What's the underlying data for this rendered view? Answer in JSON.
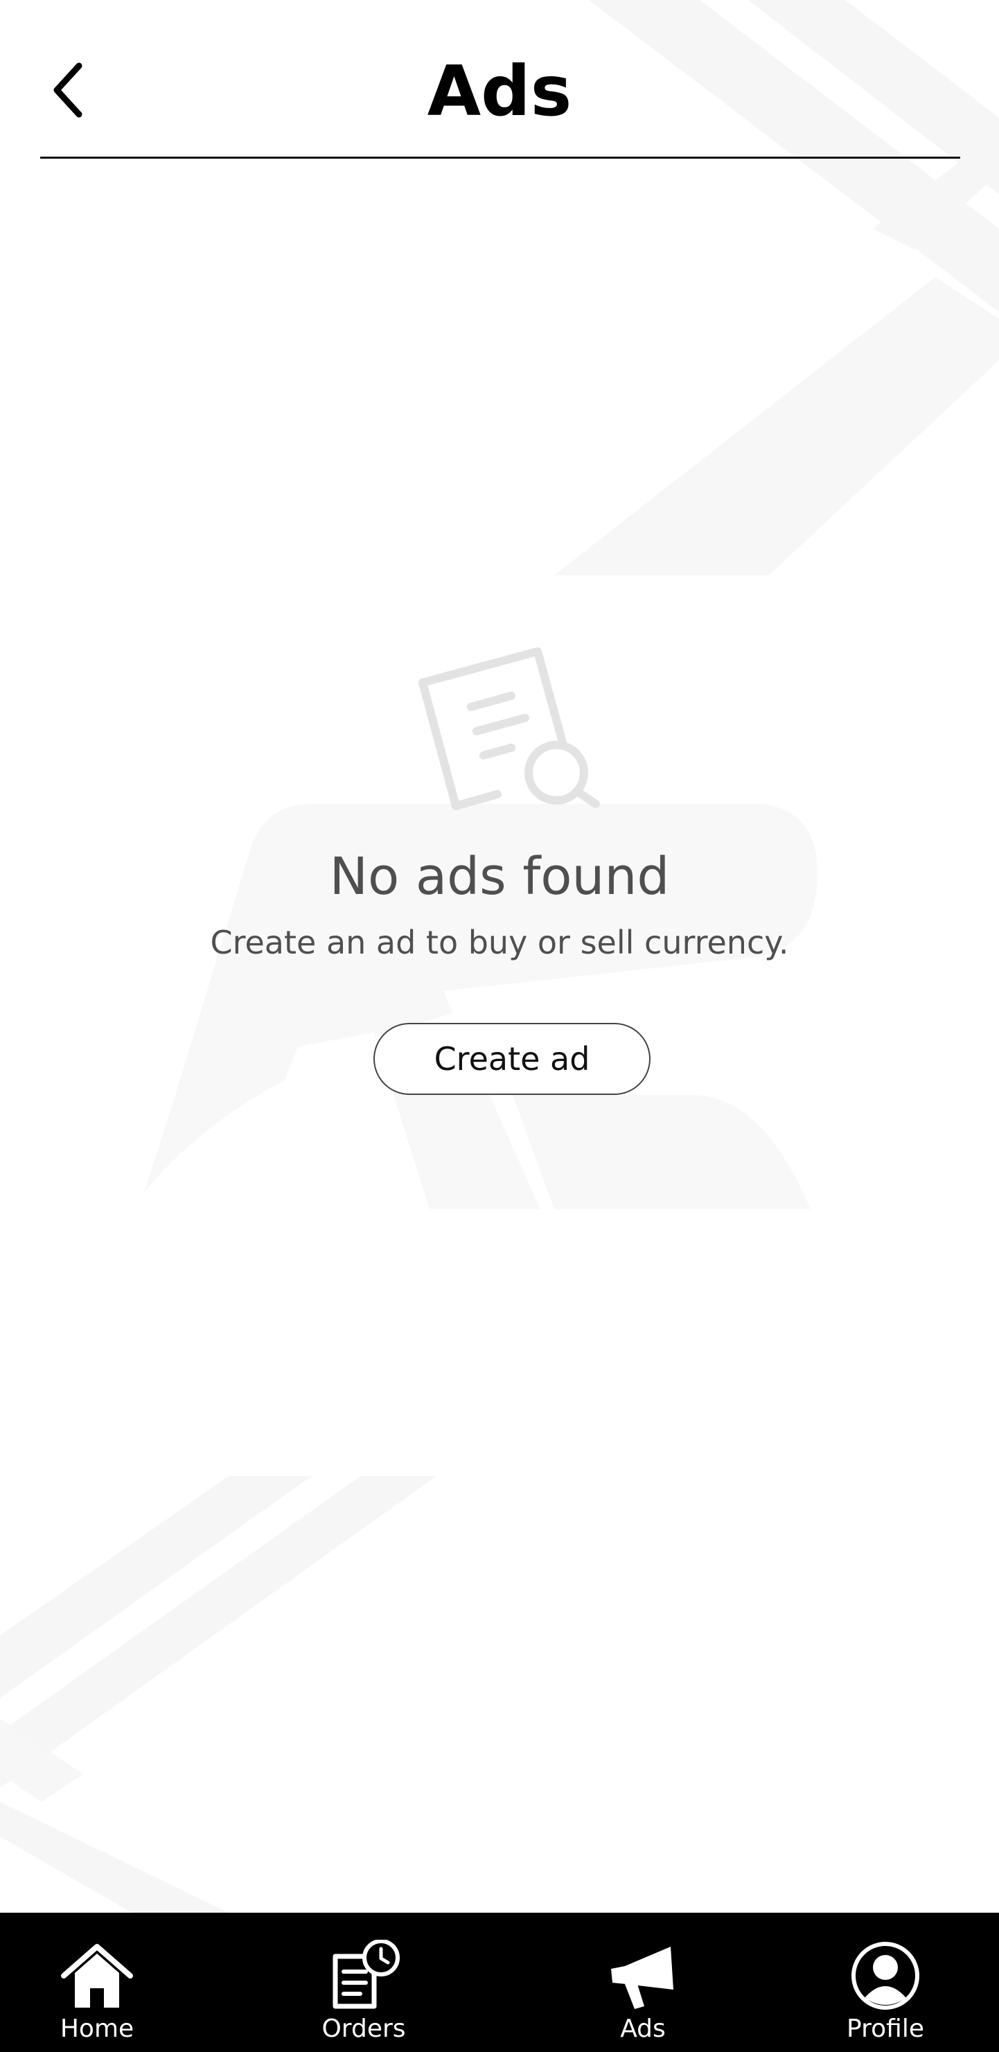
{
  "header": {
    "title": "Ads",
    "back_icon": "chevron-left-icon"
  },
  "empty_state": {
    "icon": "document-search-icon",
    "title": "No ads found",
    "subtitle": "Create an ad to buy or sell currency.",
    "button_label": "Create ad"
  },
  "bottom_nav": {
    "items": [
      {
        "label": "Home",
        "icon": "home-icon"
      },
      {
        "label": "Orders",
        "icon": "orders-clock-icon"
      },
      {
        "label": "Ads",
        "icon": "megaphone-icon"
      },
      {
        "label": "Profile",
        "icon": "user-circle-icon"
      }
    ]
  },
  "colors": {
    "background": "#ffffff",
    "nav_background": "#000000",
    "text_primary": "#000000",
    "text_muted": "#4f4f4f",
    "decoration": "#f5f5f5"
  }
}
